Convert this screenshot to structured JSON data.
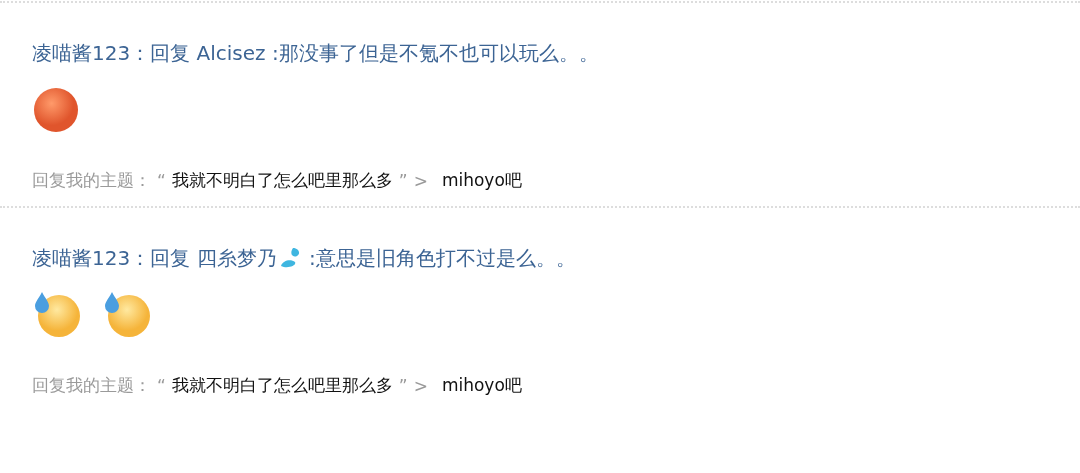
{
  "replies": [
    {
      "author": "凌喵酱123：",
      "message": [
        {
          "kind": "text",
          "text": "回复 Alcisez :那没事了但是不氪不也可以玩么。。"
        }
      ],
      "emojis": [
        {
          "kind": "smirk"
        }
      ],
      "footer": {
        "label": "回复我的主题：",
        "open_quote": "“",
        "topic": "我就不明白了怎么吧里那么多",
        "close_quote": "”",
        "arrow": ">",
        "forum": "mihoyo吧"
      }
    },
    {
      "author": "凌喵酱123：",
      "message": [
        {
          "kind": "text",
          "text": "回复 四糸梦乃"
        },
        {
          "kind": "drop"
        },
        {
          "kind": "text",
          "text": " :意思是旧角色打不过是么。。"
        }
      ],
      "emojis": [
        {
          "kind": "sweat"
        },
        {
          "kind": "sweat"
        }
      ],
      "footer": {
        "label": "回复我的主题：",
        "open_quote": "“",
        "topic": "我就不明白了怎么吧里那么多",
        "close_quote": "”",
        "arrow": ">",
        "forum": "mihoyo吧"
      }
    }
  ]
}
